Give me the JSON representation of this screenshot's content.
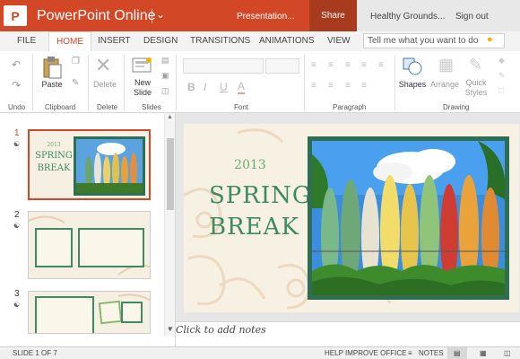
{
  "titlebar": {
    "logo_letter": "P",
    "app_name": "PowerPoint Online",
    "doc_name": "Presentation...",
    "share_label": "Share",
    "account_name": "Healthy Grounds...",
    "signout_label": "Sign out"
  },
  "tabs": [
    "FILE",
    "HOME",
    "INSERT",
    "DESIGN",
    "TRANSITIONS",
    "ANIMATIONS",
    "VIEW"
  ],
  "active_tab": "HOME",
  "tellme_placeholder": "Tell me what you want to do",
  "ribbon": {
    "paste_label": "Paste",
    "delete_label": "Delete",
    "new_slide_label_1": "New",
    "new_slide_label_2": "Slide",
    "shapes_label": "Shapes",
    "arrange_label": "Arrange",
    "quick_styles_label_1": "Quick",
    "quick_styles_label_2": "Styles",
    "groups": [
      "Undo",
      "Clipboard",
      "Delete",
      "Slides",
      "Font",
      "Paragraph",
      "Drawing"
    ]
  },
  "slides_panel": {
    "numbers": [
      "1",
      "2",
      "3"
    ],
    "selected": 1,
    "thumb1_year": "2013",
    "thumb1_title_1": "SPRING",
    "thumb1_title_2": "BREAK"
  },
  "slide": {
    "year": "2013",
    "title_line1": "SPRING",
    "title_line2": "BREAK"
  },
  "notes_placeholder": "Click to add notes",
  "status": {
    "slide_count": "SLIDE 1 OF 7",
    "help_improve": "HELP IMPROVE OFFICE",
    "notes_label": "NOTES"
  },
  "colors": {
    "accent": "#d24726",
    "share_bg": "#a83a1d",
    "slide_bg": "#f6f1e3",
    "title_green": "#3f8a62",
    "frame_green": "#2e6e55"
  }
}
